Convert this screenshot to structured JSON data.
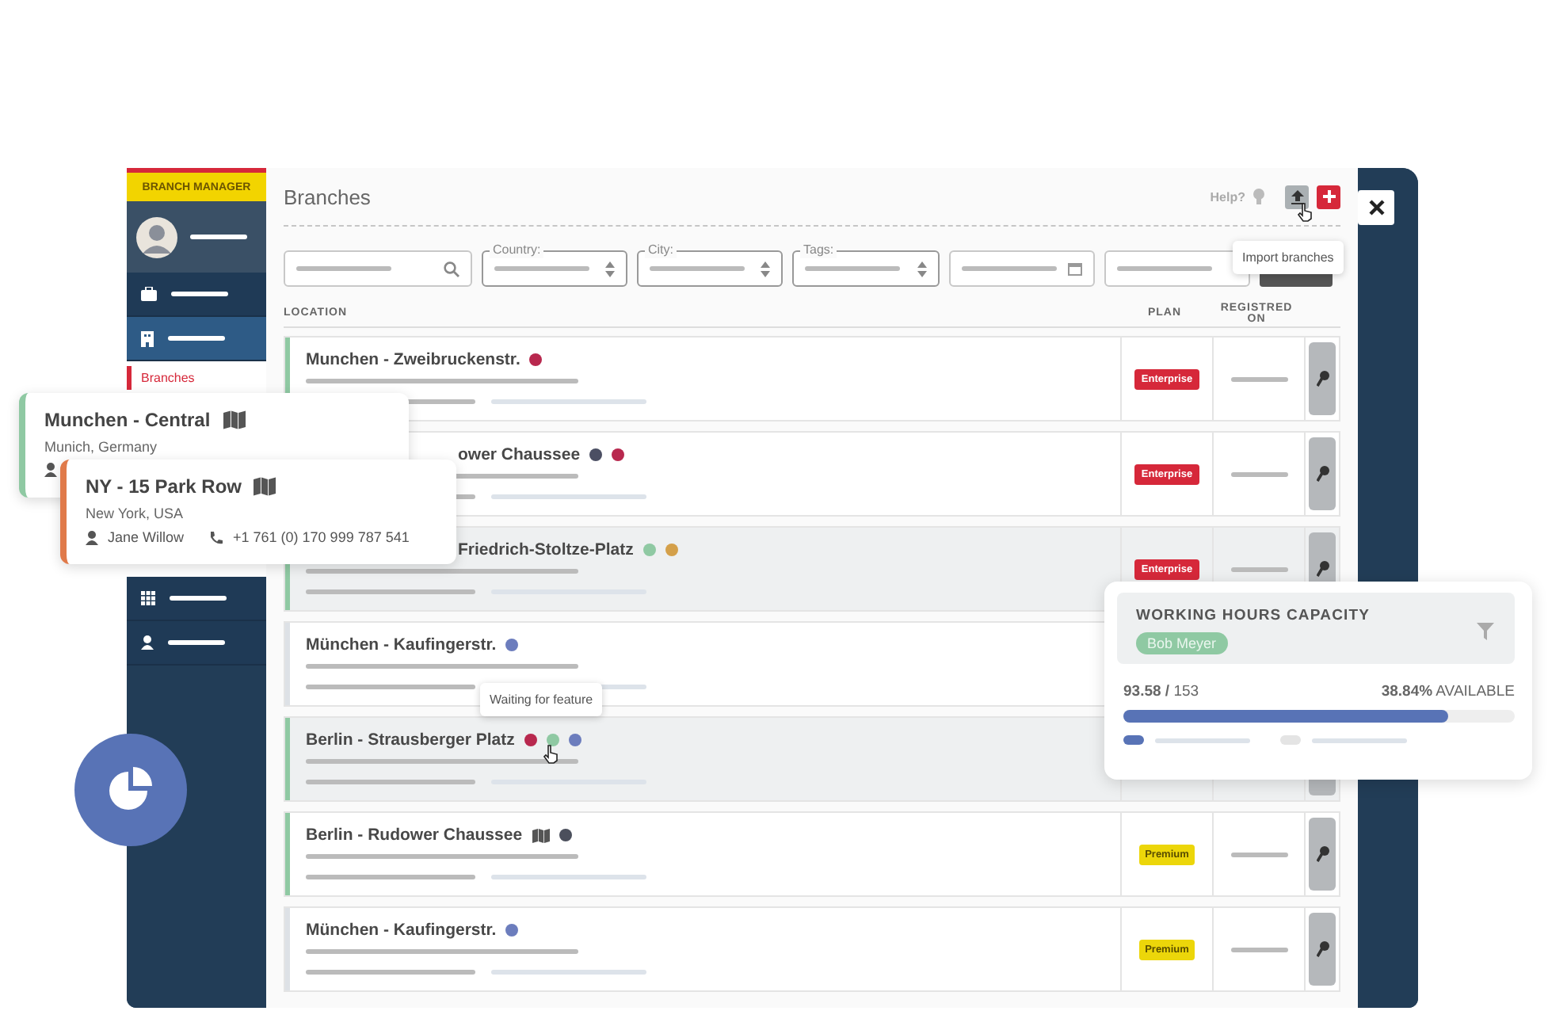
{
  "sidebar": {
    "badge": "BRANCH MANAGER",
    "items": [
      {
        "kind": "briefcase",
        "selected": false
      },
      {
        "kind": "building",
        "selected": true,
        "children": [
          {
            "label": "Branches",
            "selected": true
          }
        ]
      },
      {
        "kind": "grid",
        "selected": false
      },
      {
        "kind": "person",
        "selected": false
      }
    ]
  },
  "header": {
    "title": "Branches",
    "help": "Help?",
    "tooltip": "Import branches"
  },
  "filters": [
    {
      "kind": "search"
    },
    {
      "kind": "select",
      "label": "Country:"
    },
    {
      "kind": "select",
      "label": "City:"
    },
    {
      "kind": "select",
      "label": "Tags:"
    },
    {
      "kind": "date"
    },
    {
      "kind": "text"
    },
    {
      "kind": "button"
    }
  ],
  "table": {
    "columns": [
      "LOCATION",
      "PLAN",
      "REGISTRED ON"
    ],
    "rows": [
      {
        "name": "Munchen - Zweibruckenstr.",
        "dots": [
          {
            "color": "#b8284e"
          }
        ],
        "plan": {
          "label": "Enterprise",
          "kind": "enterprise"
        },
        "highlighted": false,
        "color": "#8fc9a3"
      },
      {
        "name": "ower Chaussee",
        "dots": [
          {
            "color": "#4b4f63"
          },
          {
            "color": "#b8284e"
          }
        ],
        "plan": {
          "label": "Enterprise",
          "kind": "enterprise"
        },
        "highlighted": false
      },
      {
        "name": "Friedrich-Stoltze-Platz",
        "dots": [
          {
            "color": "#8fc9a3"
          },
          {
            "color": "#d4a04a"
          }
        ],
        "plan": {
          "label": "Enterprise",
          "kind": "enterprise"
        },
        "highlighted": true,
        "color": "#8fc9a3"
      },
      {
        "name": "München - Kaufingerstr.",
        "dots": [
          {
            "color": "#6c7dbd"
          }
        ],
        "highlighted": false,
        "color": "#dde1e6"
      },
      {
        "name": "Berlin - Strausberger Platz",
        "dots": [
          {
            "color": "#b8284e"
          },
          {
            "color": "#8fc9a3"
          },
          {
            "color": "#6c7dbd"
          }
        ],
        "highlighted": true,
        "color": "#8fc9a3"
      },
      {
        "name": "Berlin - Rudower Chaussee",
        "map": true,
        "dots": [
          {
            "color": "#4b4f5c"
          }
        ],
        "plan": {
          "label": "Premium",
          "kind": "premium"
        },
        "highlighted": false,
        "color": "#8fc9a3"
      },
      {
        "name": "München - Kaufingerstr.",
        "dots": [
          {
            "color": "#6c7dbd"
          }
        ],
        "plan": {
          "label": "Premium",
          "kind": "premium"
        },
        "highlighted": false,
        "color": "#dde1e6"
      }
    ]
  },
  "dot_tooltip": "Waiting for feature",
  "cards": [
    {
      "title": "Munchen - Central",
      "place": "Munich, Germany",
      "color": "#8fc9a3"
    },
    {
      "title": "NY - 15 Park Row",
      "place": "New York, USA",
      "contact": "Jane Willow",
      "phone": "+1 761 (0) 170 999 787 541",
      "color": "#e07a4a"
    }
  ],
  "capacity": {
    "title": "WORKING HOURS CAPACITY",
    "person": "Bob Meyer",
    "used": "**93.58 /** 153",
    "available": "**38.84%** AVAILABLE",
    "level": 0.83
  }
}
